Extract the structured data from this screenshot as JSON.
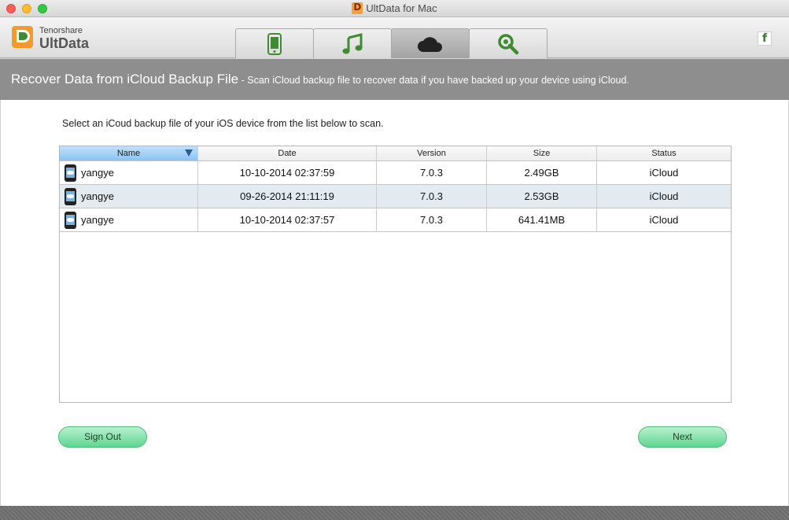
{
  "window": {
    "title": "UltData for Mac"
  },
  "brand": {
    "company": "Tenorshare",
    "product": "UltData"
  },
  "tabs": [
    {
      "icon": "phone-icon",
      "active": false
    },
    {
      "icon": "music-note-icon",
      "active": false
    },
    {
      "icon": "cloud-icon",
      "active": true
    },
    {
      "icon": "repair-icon",
      "active": false
    }
  ],
  "social": {
    "icon": "facebook-icon",
    "label": "f"
  },
  "header": {
    "title": "Recover Data from iCloud Backup File",
    "subtitle": " - Scan iCloud backup file to recover data if you have backed up your device using iCloud."
  },
  "instruction": "Select an iCoud backup file of your iOS device from the list below to scan.",
  "table": {
    "columns": [
      "Name",
      "Date",
      "Version",
      "Size",
      "Status"
    ],
    "rows": [
      {
        "name": "yangye",
        "date": "10-10-2014 02:37:59",
        "version": "7.0.3",
        "size": "2.49GB",
        "status": "iCloud"
      },
      {
        "name": "yangye",
        "date": "09-26-2014 21:11:19",
        "version": "7.0.3",
        "size": "2.53GB",
        "status": "iCloud"
      },
      {
        "name": "yangye",
        "date": "10-10-2014 02:37:57",
        "version": "7.0.3",
        "size": "641.41MB",
        "status": "iCloud"
      }
    ]
  },
  "buttons": {
    "sign_out": "Sign Out",
    "next": "Next"
  },
  "colors": {
    "accent_green": "#5fd691",
    "header_band": "#8e8e8e",
    "selected_row": "#e3ebf1",
    "sorted_header": "#8cc4f4"
  }
}
